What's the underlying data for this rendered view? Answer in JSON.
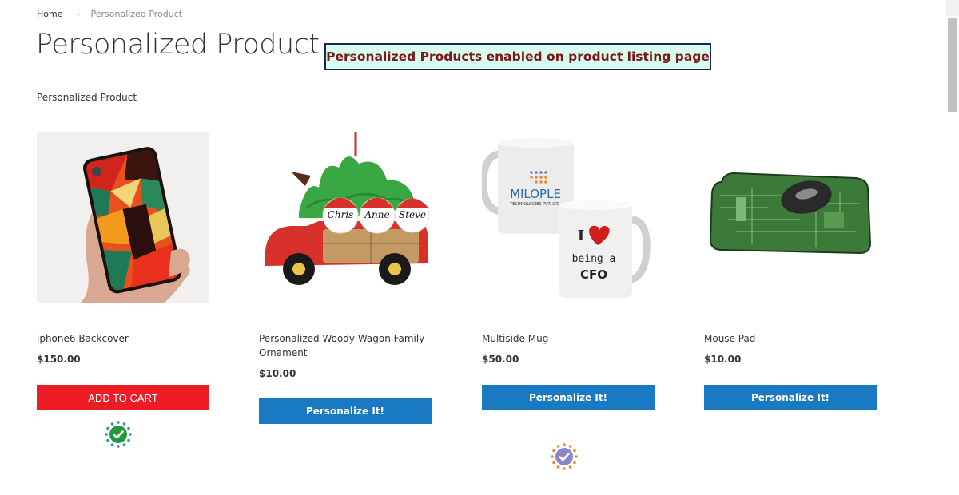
{
  "breadcrumb": {
    "home": "Home",
    "separator": "›",
    "current": "Personalized Product"
  },
  "page_title": "Personalized Product",
  "notice": {
    "text": "Personalized Products enabled on product listing page",
    "text_color": "#7a1717",
    "bg_color": "#d8fbf0",
    "border_color": "#1c2450"
  },
  "category_label": "Personalized Product",
  "colors": {
    "add_to_cart": "#ed1c24",
    "personalize": "#1979c3"
  },
  "products": [
    {
      "name": "iphone6 Backcover",
      "price": "$150.00",
      "button": "ADD TO CART",
      "image": "phone-case-image",
      "badge": "green-check-badge"
    },
    {
      "name": "Personalized Woody Wagon Family Ornament",
      "price": "$10.00",
      "button": "Personalize It!",
      "image": "wagon-ornament-image",
      "ornament_names": [
        "Chris",
        "Anne",
        "Steve"
      ]
    },
    {
      "name": "Multiside Mug",
      "price": "$50.00",
      "button": "Personalize It!",
      "image": "mug-image",
      "mug_text": {
        "brand": "MILOPLE",
        "brand_sub": "TECHNOLOGIES PVT. LTD.",
        "slogan_1": "I",
        "slogan_2": "being a",
        "slogan_3": "CFO"
      },
      "badge": "purple-check-badge"
    },
    {
      "name": "Mouse Pad",
      "price": "$10.00",
      "button": "Personalize It!",
      "image": "mouse-pad-image"
    }
  ]
}
